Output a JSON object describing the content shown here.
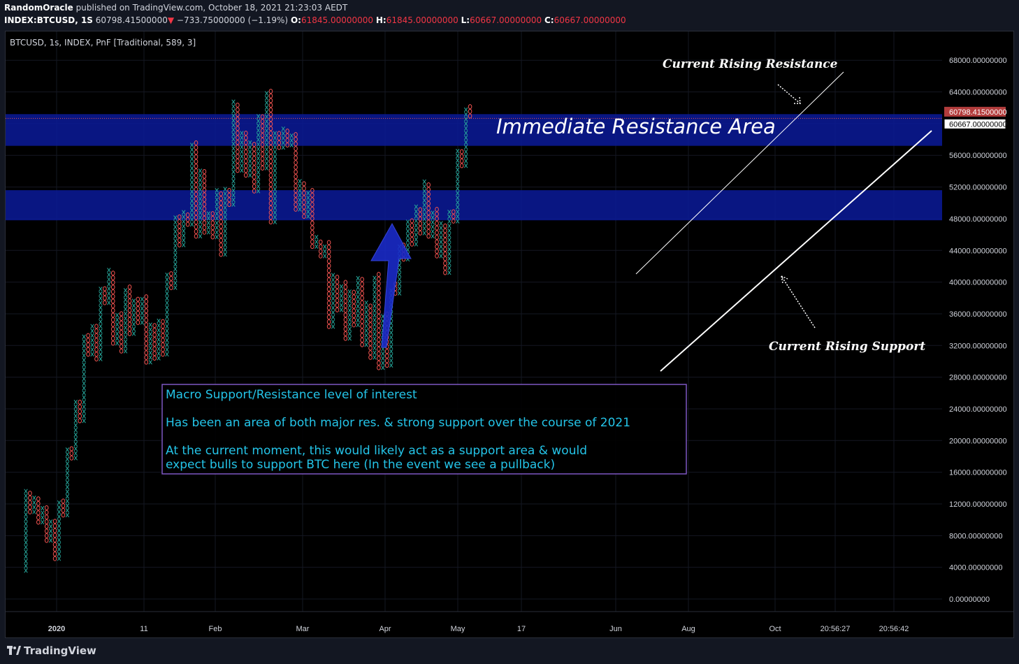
{
  "header": {
    "author": "RandomOracle",
    "published": "published on TradingView.com, October 18, 2021 21:23:03 AEDT",
    "symbol": "INDEX:BTCUSD, 1S",
    "last": "60798.41500000",
    "change": "−733.75000000 (−1.19%)",
    "o_label": "O:",
    "o_value": "61845.00000000",
    "h_label": "H:",
    "h_value": "61845.00000000",
    "l_label": "L:",
    "l_value": "60667.00000000",
    "c_label": "C:",
    "c_value": "60667.00000000"
  },
  "legend": "BTCUSD, 1s, INDEX, PnF [Traditional, 589, 3]",
  "brand": "TradingView",
  "colors": {
    "x": "#26a69a",
    "o": "#ef5350",
    "zone": "#0a1a99",
    "note_border": "#7e57c2",
    "note_text": "#24c4e8",
    "arrow": "#1a2bc8"
  },
  "chart_data": {
    "type": "point-and-figure",
    "box_size": 589,
    "reversal": 3,
    "ylim": [
      0,
      68000
    ],
    "y_ticks": [
      0,
      4000,
      8000,
      12000,
      16000,
      20000,
      24000,
      28000,
      32000,
      36000,
      40000,
      44000,
      48000,
      52000,
      56000,
      60000,
      64000,
      68000
    ],
    "y_tick_labels": [
      "0.00000000",
      "4000.00000000",
      "8000.00000000",
      "12000.00000000",
      "16000.00000000",
      "20000.00000000",
      "24000.00000000",
      "28000.00000000",
      "32000.00000000",
      "36000.00000000",
      "40000.00000000",
      "44000.00000000",
      "48000.00000000",
      "52000.00000000",
      "56000.00000000",
      "60000.00000000",
      "64000.00000000",
      "68000.00000000"
    ],
    "x_labels": [
      "2020",
      "11",
      "Feb",
      "Mar",
      "Apr",
      "May",
      "17",
      "Jun",
      "Aug",
      "Oct",
      "20:56:27",
      "20:56:42"
    ],
    "price_labels": [
      {
        "value": 60798.415,
        "text": "60798.41500000",
        "color": "#b23c3c"
      },
      {
        "value": 60667,
        "text": "60667.00000000",
        "color": "#ffffff"
      }
    ],
    "zones": [
      {
        "low": 57200,
        "high": 61200
      },
      {
        "low": 47800,
        "high": 51600
      }
    ],
    "pivots": [
      3300,
      13700,
      10700,
      13100,
      9400,
      11800,
      7100,
      10300,
      4800,
      12400,
      10300,
      19200,
      17500,
      25100,
      22200,
      33500,
      30600,
      34600,
      30000,
      39700,
      37100,
      41600,
      32000,
      36300,
      31000,
      39500,
      33200,
      37900,
      34600,
      38300,
      29600,
      35000,
      30100,
      35300,
      30600,
      41400,
      39000,
      48300,
      44400,
      49000,
      47000,
      57800,
      45500,
      54200,
      46000,
      49000,
      45400,
      51600,
      43200,
      51900,
      49500,
      62800,
      53800,
      58900,
      53200,
      57700,
      51200,
      61000,
      54100,
      64300,
      47300,
      59300,
      56700,
      59500,
      57000,
      59000,
      48900,
      52800,
      48000,
      51600,
      44200,
      45500,
      43000,
      45000,
      34100,
      41000,
      36200,
      40000,
      32600,
      39000,
      34300,
      40600,
      31800,
      37500,
      30200,
      41000,
      28900,
      36000,
      29200,
      39500,
      38300,
      45000,
      42600,
      48000,
      44500,
      49600,
      45900,
      52700,
      45500,
      49300,
      43000,
      47600,
      40900,
      48900,
      47400,
      56600,
      54400,
      62300,
      60667
    ]
  },
  "annotations": {
    "resistance_area": "Immediate Resistance Area",
    "rising_resistance": "Current Rising Resistance",
    "rising_support": "Current Rising Support",
    "note_line1": "Macro Support/Resistance level of interest",
    "note_line2": "Has been an area of both major res. & strong support over the course of 2021",
    "note_line3": "At the current moment, this would likely act as a support area & would",
    "note_line4": "expect bulls to support BTC here (In the event we see a pullback)"
  }
}
